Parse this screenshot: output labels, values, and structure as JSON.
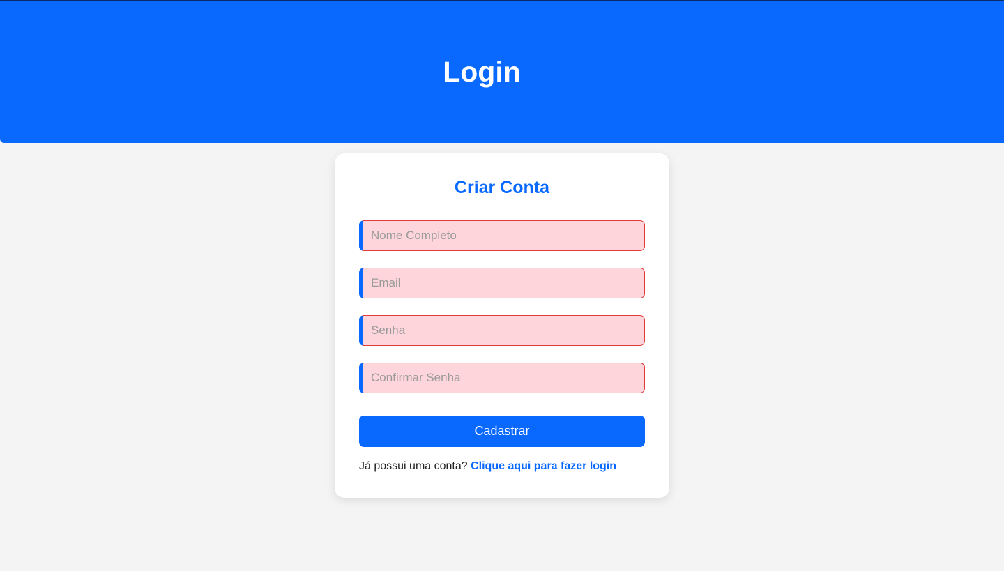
{
  "header": {
    "title": "Login"
  },
  "form": {
    "title": "Criar Conta",
    "fields": [
      {
        "placeholder": "Nome Completo",
        "value": ""
      },
      {
        "placeholder": "Email",
        "value": ""
      },
      {
        "placeholder": "Senha",
        "value": ""
      },
      {
        "placeholder": "Confirmar Senha",
        "value": ""
      }
    ],
    "submit_label": "Cadastrar",
    "login_prompt": "Já possui uma conta?",
    "login_link": "Clique aqui para fazer login"
  },
  "colors": {
    "primary": "#0969ff",
    "page_background": "#f4f4f4",
    "field_error_background": "#fdd5da",
    "field_error_border": "#e03a3a"
  }
}
